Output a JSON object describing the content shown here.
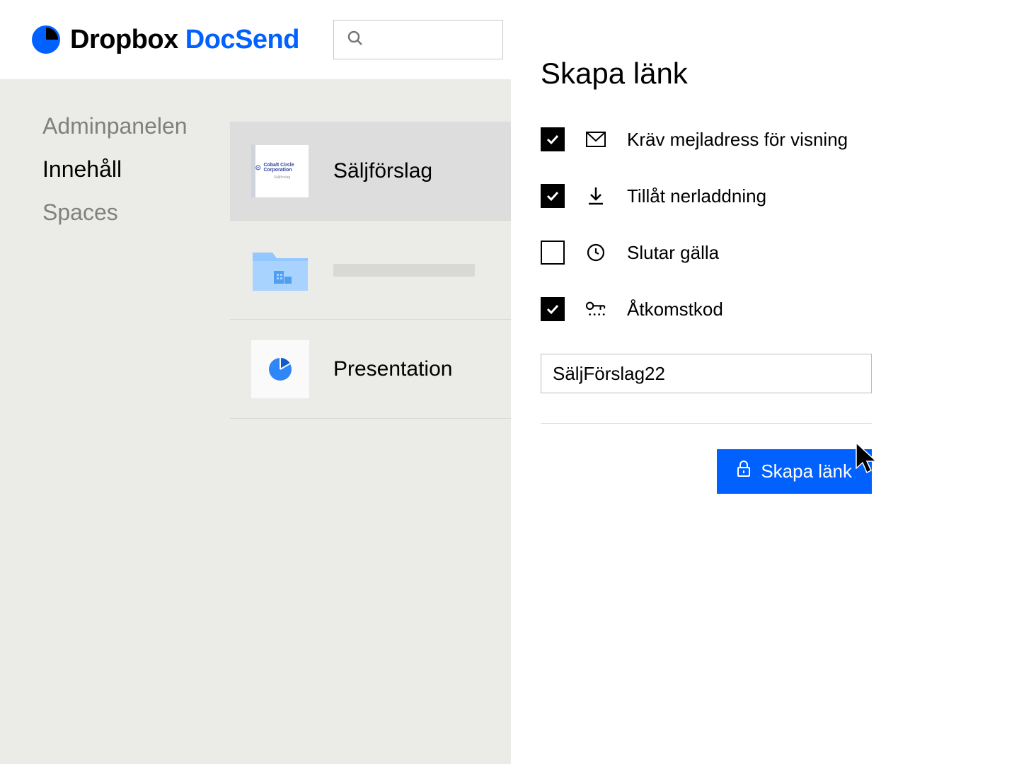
{
  "header": {
    "brand1": "Dropbox",
    "brand2": "DocSend",
    "search_placeholder": ""
  },
  "sidebar": {
    "items": [
      {
        "label": "Adminpanelen",
        "active": false
      },
      {
        "label": "Innehåll",
        "active": true
      },
      {
        "label": "Spaces",
        "active": false
      }
    ]
  },
  "content": {
    "rows": [
      {
        "title": "Säljförslag",
        "type": "document",
        "thumb_company": "Cobalt Circle Corporation"
      },
      {
        "title": "",
        "type": "folder"
      },
      {
        "title": "Presentation",
        "type": "chart"
      }
    ]
  },
  "panel": {
    "title": "Skapa länk",
    "options": [
      {
        "label": "Kräv mejladress för visning",
        "checked": true,
        "icon": "mail"
      },
      {
        "label": "Tillåt nerladdning",
        "checked": true,
        "icon": "download"
      },
      {
        "label": "Slutar gälla",
        "checked": false,
        "icon": "clock"
      },
      {
        "label": "Åtkomstkod",
        "checked": true,
        "icon": "key"
      }
    ],
    "code_value": "SäljFörslag22",
    "button_label": "Skapa länk"
  },
  "colors": {
    "accent": "#0061fe"
  }
}
